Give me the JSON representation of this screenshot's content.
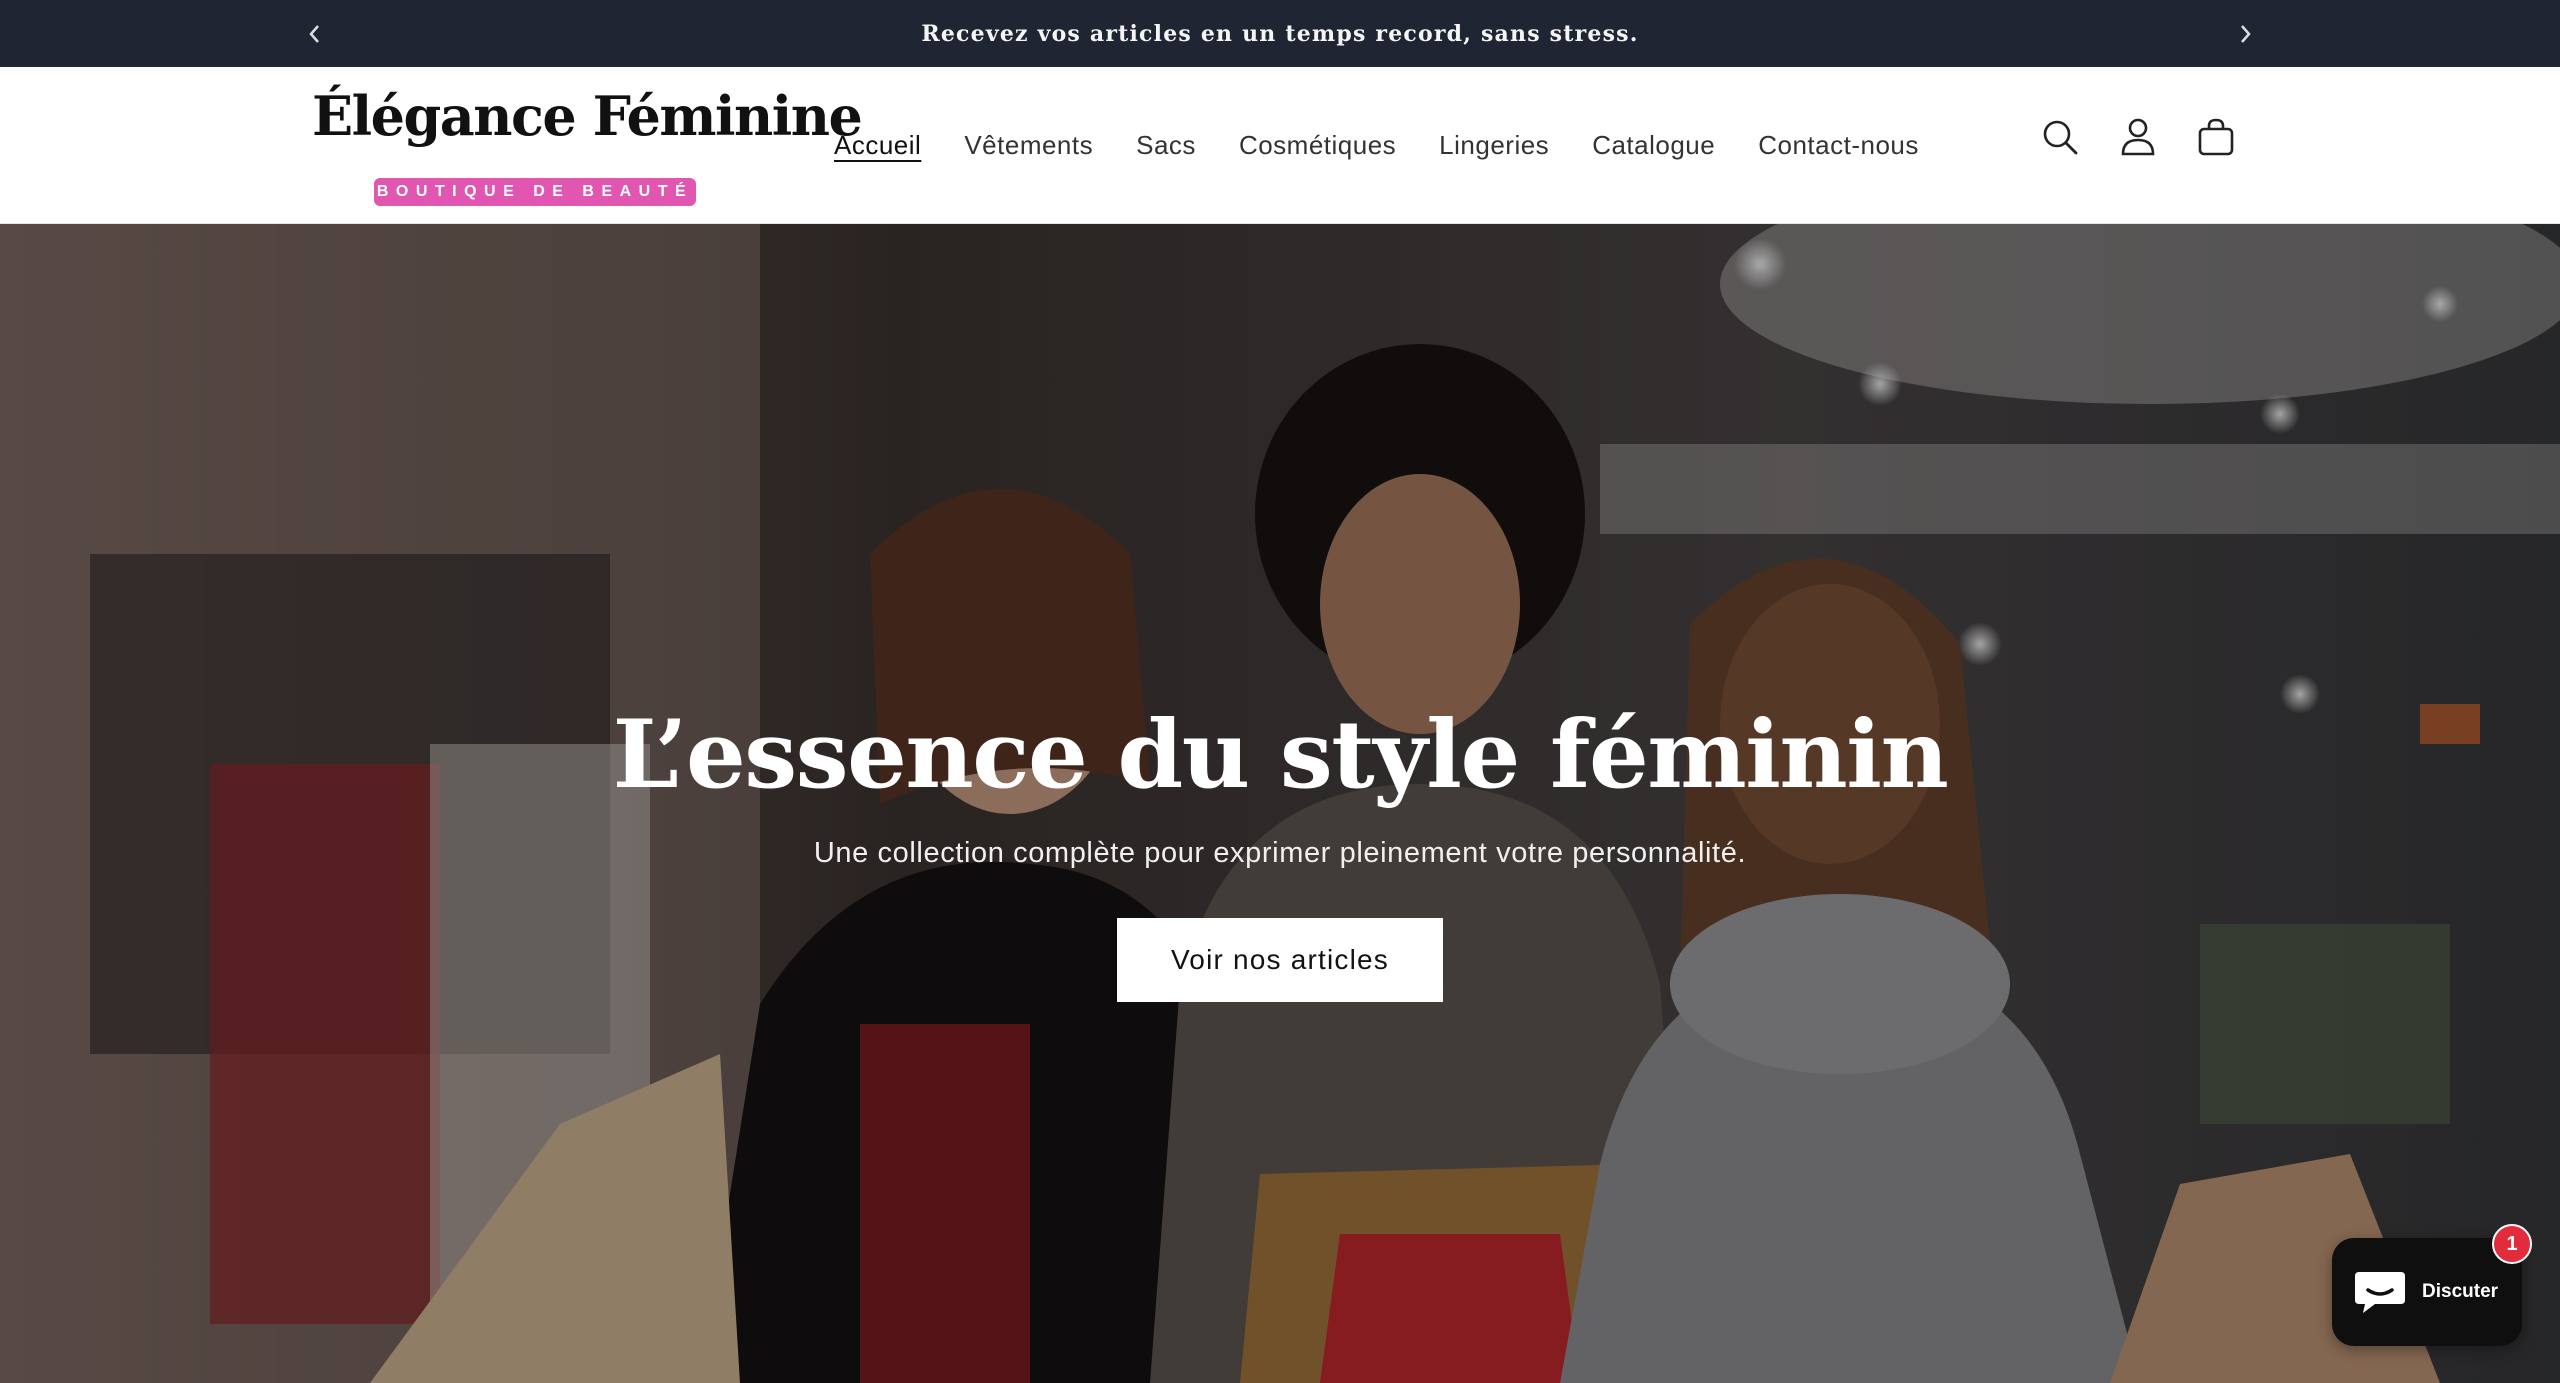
{
  "announcement": {
    "text": "Recevez vos articles en un temps record, sans stress.",
    "prev_icon": "chevron-left-icon",
    "next_icon": "chevron-right-icon"
  },
  "header": {
    "logo_title": "Élégance Féminine",
    "logo_tagline": "BOUTIQUE DE BEAUTÉ",
    "nav": [
      {
        "label": "Accueil",
        "active": true
      },
      {
        "label": "Vêtements"
      },
      {
        "label": "Sacs"
      },
      {
        "label": "Cosmétiques"
      },
      {
        "label": "Lingeries"
      },
      {
        "label": "Catalogue"
      },
      {
        "label": "Contact-nous"
      }
    ],
    "icons": [
      "search-icon",
      "account-icon",
      "cart-icon"
    ]
  },
  "hero": {
    "title": "L’essence du style féminin",
    "subtitle": "Une collection complète pour exprimer pleinement votre personnalité.",
    "button_label": "Voir nos articles"
  },
  "chat": {
    "label": "Discuter",
    "badge": "1"
  },
  "colors": {
    "announcement_bg": "#1f2532",
    "logo_tag_bg": "#e056b0",
    "chat_badge": "#e32c3b"
  }
}
